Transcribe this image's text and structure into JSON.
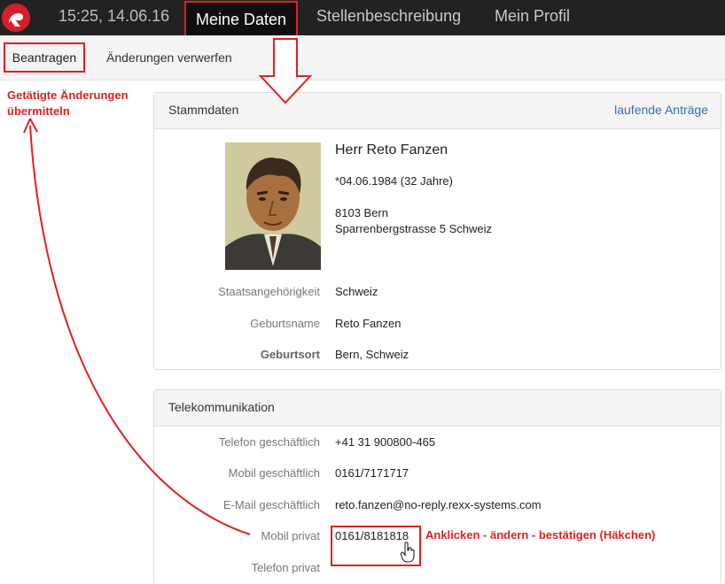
{
  "nav": {
    "logo_icon": "rexx-logo-icon",
    "datetime": "15:25, 14.06.16",
    "tabs": [
      {
        "label": "Meine Daten",
        "active": true
      },
      {
        "label": "Stellenbeschreibung",
        "active": false
      },
      {
        "label": "Mein Profil",
        "active": false
      }
    ]
  },
  "toolbar": {
    "apply_label": "Beantragen",
    "discard_label": "Änderungen verwerfen"
  },
  "annotations": {
    "left_line1": "Getätigte Änderungen",
    "left_line2": "übermitteln",
    "right": "Anklicken - ändern - bestätigen (Häkchen)",
    "accent_color": "#e02020"
  },
  "stammdaten": {
    "title": "Stammdaten",
    "link": "laufende Anträge",
    "name": "Herr Reto Fanzen",
    "birth": "*04.06.1984 (32 Jahre)",
    "city": "8103 Bern",
    "street": "Sparrenbergstrasse 5 Schweiz",
    "rows": [
      {
        "label": "Staatsangehörigkeit",
        "value": "Schweiz"
      },
      {
        "label": "Geburtsname",
        "value": "Reto Fanzen"
      },
      {
        "label": "Geburtsort",
        "value": "Bern, Schweiz"
      }
    ]
  },
  "telekommunikation": {
    "title": "Telekommunikation",
    "rows": [
      {
        "label": "Telefon geschäftlich",
        "value": "+41 31 900800-465"
      },
      {
        "label": "Mobil geschäftlich",
        "value": "0161/7171717"
      },
      {
        "label": "E-Mail geschäftlich",
        "value": "reto.fanzen@no-reply.rexx-systems.com"
      },
      {
        "label": "Mobil privat",
        "value": "0161/8181818"
      },
      {
        "label": "Telefon privat",
        "value": ""
      }
    ]
  }
}
